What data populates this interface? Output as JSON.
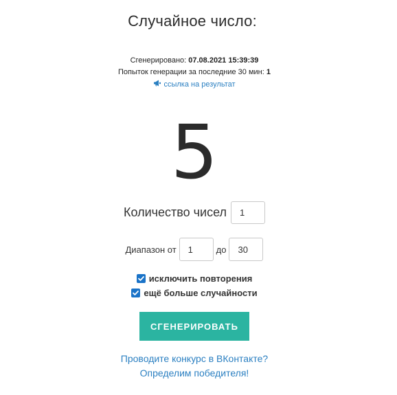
{
  "title": "Случайное число:",
  "generated": {
    "label": "Сгенерировано: ",
    "value": "07.08.2021 15:39:39"
  },
  "attempts": {
    "label": "Попыток генерации за последние 30 мин: ",
    "value": "1"
  },
  "result_link": {
    "icon": "megaphone-icon",
    "label": "ссылка на результат"
  },
  "result": "5",
  "count": {
    "label": "Количество чисел",
    "value": "1"
  },
  "range": {
    "label": "Диапазон от",
    "from": "1",
    "to_label": "до",
    "to": "30"
  },
  "options": [
    {
      "label": "исключить повторения",
      "checked": true
    },
    {
      "label": "ещё больше случайности",
      "checked": true
    }
  ],
  "generate_button": "СГЕНЕРИРОВАТЬ",
  "promo": {
    "line1": "Проводите конкурс в ВКонтакте?",
    "line2": "Определим победителя!"
  },
  "colors": {
    "accent_button": "#2bb4a1",
    "link": "#2a7fc1",
    "checkbox": "#1a73c8"
  }
}
